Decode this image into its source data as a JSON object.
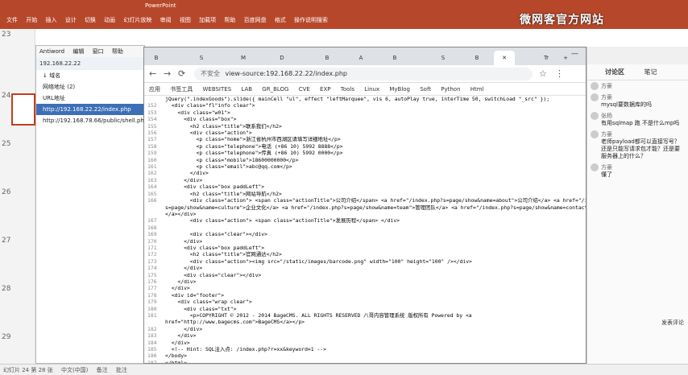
{
  "ppt": {
    "title": "PowerPoint",
    "ribbon": [
      "文件",
      "开始",
      "插入",
      "设计",
      "切换",
      "动画",
      "幻灯片放映",
      "审阅",
      "视图",
      "加载项",
      "帮助",
      "百度网盘",
      "格式",
      "操作说明搜索"
    ],
    "brand": "微网客官方网站",
    "slide_numbers": [
      "23",
      "24",
      "25",
      "26",
      "27",
      "28",
      "29"
    ],
    "status": [
      "幻灯片 24 第 28 张",
      "中文(中国)",
      "备注",
      "批注"
    ]
  },
  "notes": {
    "menu": [
      "Antiword",
      "编辑",
      "窗口",
      "帮助"
    ],
    "address": "192.168.22.22",
    "tree": [
      "↓ 域名",
      "网络地址 (2)",
      "URL地址",
      "http://192.168.22.22/index.php",
      "http://192.168.78.66/public/shell.php"
    ]
  },
  "browser": {
    "tabs": [
      "B",
      "S",
      "M",
      "D",
      "B",
      "A",
      "B",
      "S",
      "B",
      "Tr"
    ],
    "address_warning": "不安全",
    "address_url": "view-source:192.168.22.22/index.php",
    "bookmarks": [
      "应用",
      "书签工具",
      "WEBSITES",
      "LAB",
      "GR_BLOG",
      "CVE",
      "EXP",
      "Tools",
      "Linux",
      "MyBlog",
      "Soft",
      "Python",
      "Html"
    ],
    "source_lines": [
      {
        "n": "",
        "t": "jQuery(\".indexGoods\").slide({ mainCell \"ul\", effect \"leftMarquee\", vis 6, autoPlay true, interTime 50, switchLoad \"_src\" });"
      },
      {
        "n": "152",
        "t": "  <div class=\"fl\"info clear\">"
      },
      {
        "n": "153",
        "t": "    <div class=\"w01\">"
      },
      {
        "n": "154",
        "t": "      <div class=\"box\">"
      },
      {
        "n": "155",
        "t": "        <h2 class=\"title\">联系我们</h2>"
      },
      {
        "n": "156",
        "t": "        <div class=\"action\">"
      },
      {
        "n": "157",
        "t": "          <p class=\"home\">浙江省杭州市西湖区请填写详细地址</p>"
      },
      {
        "n": "158",
        "t": "          <p class=\"telephone\">电话 (+86 10) 5992 8888</p>"
      },
      {
        "n": "159",
        "t": "          <p class=\"telephone\">传真 (+86 10) 5992 0000</p>"
      },
      {
        "n": "160",
        "t": "          <p class=\"mobile\">18600000000</p>"
      },
      {
        "n": "161",
        "t": "          <p class=\"email\">abc@qq.com</p>"
      },
      {
        "n": "162",
        "t": "        </div>"
      },
      {
        "n": "163",
        "t": "      </div>"
      },
      {
        "n": "164",
        "t": "      <div class=\"box paddLeft\">"
      },
      {
        "n": "165",
        "t": "        <h2 class=\"title\">网站导航</h2>"
      },
      {
        "n": "166",
        "t": "        <div class=\"action\"> <span class=\"actionTitle\">公司介绍</span> <a href=\"/index.php?s=page/show&name=about\">公司介绍</a> <a href=\"/index"
      },
      {
        "n": "",
        "t": "s=page/show&name=culture\">企业文化</a> <a href=\"/index.php?s=page/show&name=team\">管理团队</a> <a href=\"/index.php?s=page/show&name=contact"
      },
      {
        "n": "",
        "t": "</a></div>"
      },
      {
        "n": "167",
        "t": "        <div class=\"action\"> <span class=\"actionTitle\">发展历程</span> </div>"
      },
      {
        "n": "168",
        "t": ""
      },
      {
        "n": "169",
        "t": "        <div class=\"clear\"></div>"
      },
      {
        "n": "170",
        "t": "      </div>"
      },
      {
        "n": "171",
        "t": "      <div class=\"box paddLeft\">"
      },
      {
        "n": "172",
        "t": "        <h2 class=\"title\">官网通达</h2>"
      },
      {
        "n": "173",
        "t": "        <div class=\"action\"><img src=\"/static/images/barcode.png\" width=\"100\" height=\"100\" /></div>"
      },
      {
        "n": "174",
        "t": "      </div>"
      },
      {
        "n": "175",
        "t": "      <div class=\"clear\"></div>"
      },
      {
        "n": "176",
        "t": "    </div>"
      },
      {
        "n": "177",
        "t": "  </div>"
      },
      {
        "n": "178",
        "t": "  <div id=\"footer\">"
      },
      {
        "n": "179",
        "t": "    <div class=\"wrap clear\">"
      },
      {
        "n": "180",
        "t": "      <div class=\"txt\">"
      },
      {
        "n": "181",
        "t": "        <p>COPYRIGHT © 2012 - 2014 BageCMS. ALL RIGHTS RESERVED 八哥内容管理系统 版权所有 Powered by <a"
      },
      {
        "n": "",
        "t": "href=\"http://www.bagecms.com\">BageCMS</a></p>"
      },
      {
        "n": "182",
        "t": "      </div>"
      },
      {
        "n": "183",
        "t": "    </div>"
      },
      {
        "n": "184",
        "t": "  </div>"
      },
      {
        "n": "185",
        "t": "  <!-- Hint: SQL注入点: /index.php?r=xx&keyword=1 -->"
      },
      {
        "n": "186",
        "t": "</body>"
      },
      {
        "n": "187",
        "t": "</html>"
      }
    ]
  },
  "chat": {
    "tabs": [
      "讨论区",
      "笔记"
    ],
    "messages": [
      {
        "who": "方豪",
        "text": ""
      },
      {
        "who": "方豪",
        "text": "mysql要数据库的吗"
      },
      {
        "who": "张杨",
        "text": "有用sqlmap 跑 不是什么mp吗"
      },
      {
        "who": "方豪",
        "text": "老师payload都可以直接写号？还是只能写请求包才能？还是要服务器上的什么？"
      },
      {
        "who": "方豪",
        "text": "懂了"
      }
    ],
    "footer": "发表评论"
  }
}
